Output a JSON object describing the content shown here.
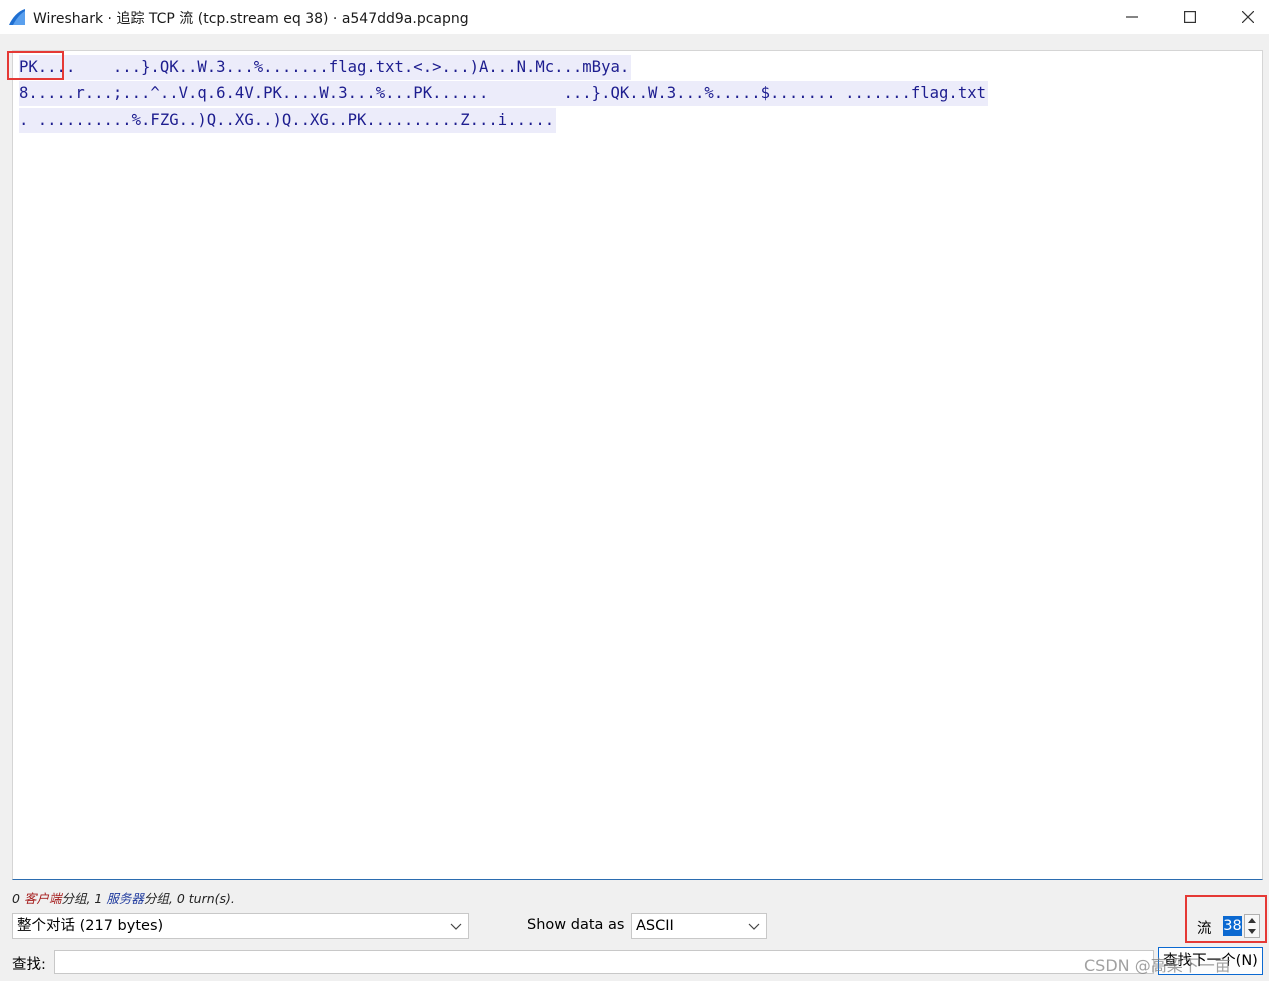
{
  "window": {
    "title": "Wireshark · 追踪 TCP 流 (tcp.stream eq 38) · a547dd9a.pcapng",
    "icons": [
      "wireshark-fin-icon",
      "minimize-icon",
      "maximize-icon",
      "close-icon"
    ]
  },
  "stream": {
    "lines": [
      "PK....    ...}.QK..W.3...%.......flag.txt.<.>...)A...N.Mc...mBya.",
      "8.....r...;...^..V.q.6.4V.PK....W.3...%...PK......        ...}.QK..W.3...%.....$....... .......flag.txt",
      ". ..........%.FZG..)Q..XG..)Q..XG..PK..........Z...i....."
    ],
    "text_color": "#1d1d8f",
    "highlight_color": "#ececfa"
  },
  "stats": {
    "client_count": "0",
    "client_label": "客户端",
    "packets_1": "分组,",
    "server_count": "1",
    "server_label": "服务器",
    "packets_2": "分组,",
    "turns": "0 turn(s)."
  },
  "controls": {
    "conversation_value": "整个对话  (217 bytes)",
    "show_data_label": "Show data as",
    "show_data_value": "ASCII",
    "stream_label": "流",
    "stream_value": "38",
    "find_label": "查找:",
    "find_value": "",
    "find_next_label": "查找下一个(N)"
  },
  "watermark": "CSDN @高梁下一亩"
}
